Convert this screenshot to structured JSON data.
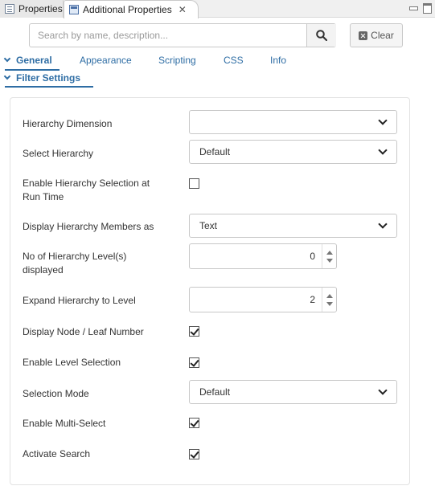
{
  "view_tabs": {
    "properties": "Properties",
    "additional_properties": "Additional Properties",
    "close_symbol": "✕"
  },
  "search": {
    "placeholder": "Search by name, description...",
    "value": "",
    "clear_label": "Clear"
  },
  "categories": {
    "general": "General",
    "appearance": "Appearance",
    "scripting": "Scripting",
    "css": "CSS",
    "info": "Info",
    "active": "General"
  },
  "section": {
    "title": "Filter Settings"
  },
  "fields": {
    "hierarchy_dimension": {
      "label": "Hierarchy Dimension",
      "value": ""
    },
    "select_hierarchy": {
      "label": "Select Hierarchy",
      "value": "Default"
    },
    "enable_hierarchy_selection": {
      "label": "Enable Hierarchy Selection at Run Time",
      "checked": false
    },
    "display_members_as": {
      "label": "Display Hierarchy Members as",
      "value": "Text"
    },
    "levels_displayed": {
      "label": "No of Hierarchy Level(s) displayed",
      "value": "0"
    },
    "expand_to_level": {
      "label": "Expand Hierarchy to Level",
      "value": "2"
    },
    "display_node_leaf": {
      "label": "Display Node / Leaf Number",
      "checked": true
    },
    "enable_level_selection": {
      "label": "Enable Level Selection",
      "checked": true
    },
    "selection_mode": {
      "label": "Selection Mode",
      "value": "Default"
    },
    "enable_multi_select": {
      "label": "Enable Multi-Select",
      "checked": true
    },
    "activate_search": {
      "label": "Activate Search",
      "checked": true
    }
  },
  "colors": {
    "accent": "#2e6da4",
    "border": "#c8c8c8",
    "text": "#333333"
  },
  "icons": [
    "properties-icon",
    "additional-properties-icon",
    "close-icon",
    "minimize-icon",
    "maximize-icon",
    "search-icon",
    "clear-icon",
    "chevron-down-icon",
    "checkbox-icon"
  ]
}
